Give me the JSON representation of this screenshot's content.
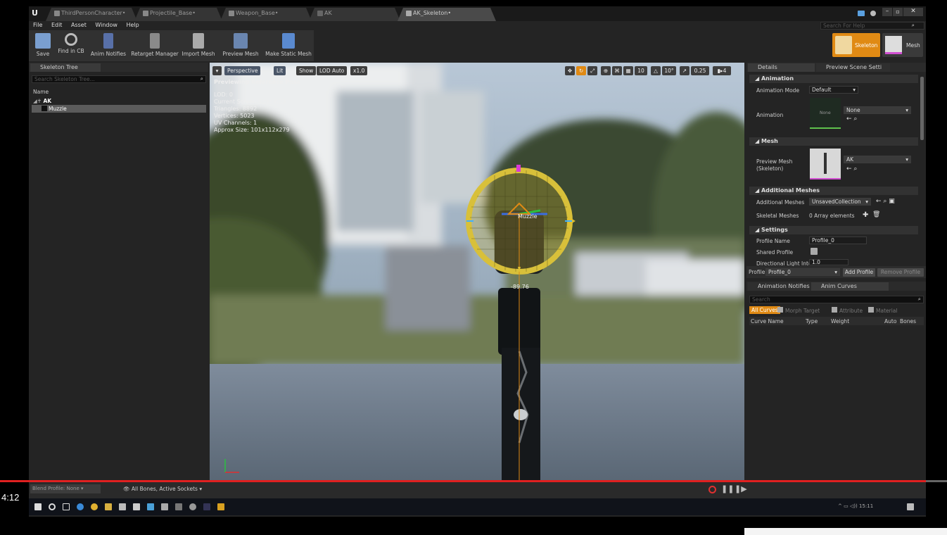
{
  "player": {
    "time": "4:12"
  },
  "tabs": [
    "ThirdPersonCharacter•",
    "Projectile_Base•",
    "Weapon_Base•",
    "AK",
    "AK_Skeleton•"
  ],
  "menu": [
    "File",
    "Edit",
    "Asset",
    "Window",
    "Help"
  ],
  "help_search_placeholder": "Search For Help",
  "toolbar": {
    "save": "Save",
    "find_in_cb": "Find in CB",
    "anim_notifies": "Anim Notifies",
    "retarget_manager": "Retarget Manager",
    "import_mesh": "Import Mesh",
    "preview_mesh": "Preview Mesh",
    "make_static_mesh": "Make Static Mesh"
  },
  "mode_buttons": {
    "skeleton": "Skeleton",
    "mesh": "Mesh"
  },
  "skeleton_tree": {
    "tab": "Skeleton Tree",
    "search_placeholder": "Search Skeleton Tree...",
    "column": "Name",
    "root": "AK",
    "child": "Muzzle",
    "footer_blend": "Blend Profile: None ▾",
    "footer_bones": "All Bones, Active Sockets ▾"
  },
  "viewport": {
    "perspective": "Perspective",
    "lit": "Lit",
    "show": "Show",
    "lod": "LOD Auto",
    "speed": "x1.0",
    "previewing": "Previewing Reference Pose",
    "stats": [
      "LOD: 0",
      "Current Screen Size: 2.33",
      "Triangles: 8892",
      "Vertices: 5023",
      "UV Channels: 1",
      "Approx Size: 101x112x279"
    ],
    "socket_label": "Muzzle",
    "angle_readout": "-89.76",
    "grid_snap": "10",
    "rot_snap": "10°",
    "scale_snap": "0.25",
    "camera_speed": "4"
  },
  "details": {
    "tab": "Details",
    "tab2": "Preview Scene Setti",
    "sections": {
      "animation": "Animation",
      "mesh": "Mesh",
      "additional": "Additional Meshes",
      "settings": "Settings"
    },
    "animation_mode_label": "Animation Mode",
    "animation_mode_value": "Default",
    "animation_label": "Animation",
    "animation_value": "None",
    "animation_thumb": "None",
    "preview_mesh_label": "Preview Mesh\n(Skeleton)",
    "preview_mesh_value": "AK",
    "additional_meshes_label": "Additional Meshes",
    "additional_meshes_value": "UnsavedCollection",
    "skeletal_meshes_label": "Skeletal Meshes",
    "skeletal_meshes_value": "0 Array elements",
    "profile_name_label": "Profile Name",
    "profile_name_value": "Profile_0",
    "shared_profile_label": "Shared Profile",
    "dir_light_label": "Directional Light Inter",
    "dir_light_value": "1.0",
    "profile_label": "Profile",
    "profile_value": "Profile_0",
    "add_profile": "Add Profile",
    "remove_profile": "Remove Profile"
  },
  "curves": {
    "tab": "Animation Notifies",
    "tab2": "Anim Curves",
    "search_placeholder": "Search",
    "filters": [
      "All Curves",
      "Morph Target",
      "Attribute",
      "Material"
    ],
    "columns": [
      "Curve Name",
      "Type",
      "Weight",
      "Auto",
      "Bones"
    ]
  },
  "systray": {
    "clock": "15:11"
  }
}
